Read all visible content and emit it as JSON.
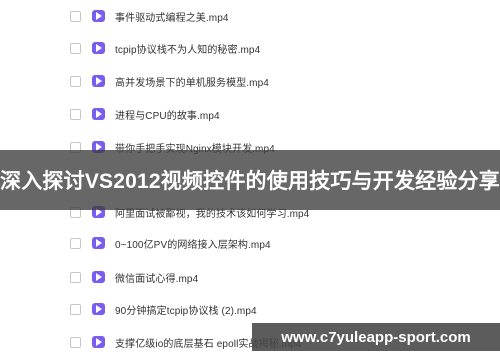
{
  "file_list": {
    "items": [
      {
        "name": "事件驱动式编程之美.mp4"
      },
      {
        "name": "tcpip协议栈不为人知的秘密.mp4"
      },
      {
        "name": "高并发场景下的单机服务模型.mp4"
      },
      {
        "name": "进程与CPU的故事.mp4"
      },
      {
        "name": "带你手把手实现Nginx模块开发.mp4"
      },
      {
        "name": "阿里面试被鄙视，我的技术该如何学习.mp4"
      },
      {
        "name": "0~100亿PV的网络接入层架构.mp4"
      },
      {
        "name": "微信面试心得.mp4"
      },
      {
        "name": "90分钟搞定tcpip协议栈 (2).mp4"
      },
      {
        "name": "支撑亿级io的底层基石 epoll实战揭秘.mp4"
      }
    ],
    "icon": "video-file-icon",
    "icon_color": "#7b5cf0"
  },
  "banner": {
    "title": "深入探讨VS2012视频控件的使用技巧与开发经验分享"
  },
  "watermark": {
    "text": "www.c7yuleapp-sport.com"
  }
}
